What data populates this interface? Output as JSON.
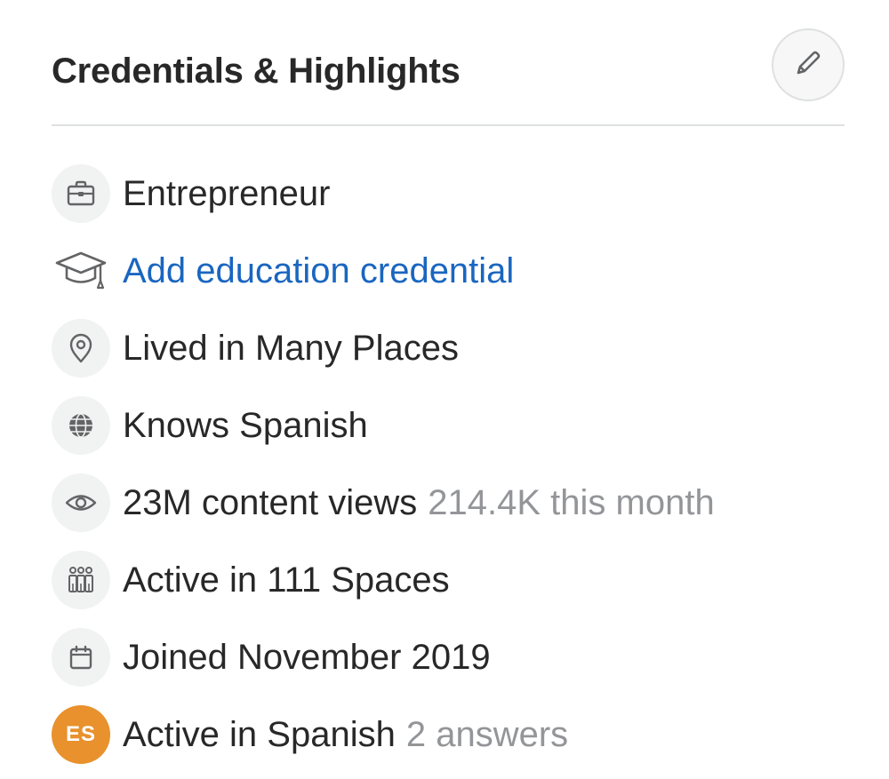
{
  "header": {
    "title": "Credentials & Highlights",
    "edit_icon": "pencil-icon"
  },
  "items": [
    {
      "icon": "briefcase-icon",
      "label": "Entrepreneur"
    },
    {
      "icon": "graduation-cap-icon",
      "label": "Add education credential",
      "is_link": true,
      "link_color": "#1a66c0"
    },
    {
      "icon": "location-pin-icon",
      "label": "Lived in Many Places"
    },
    {
      "icon": "globe-icon",
      "label": "Knows Spanish"
    },
    {
      "icon": "eye-icon",
      "label": "23M content views",
      "secondary": "214.4K this month"
    },
    {
      "icon": "people-group-icon",
      "label": "Active in 111 Spaces"
    },
    {
      "icon": "calendar-icon",
      "label": "Joined November 2019"
    },
    {
      "icon": "language-badge-icon",
      "badge_text": "ES",
      "badge_color": "#e8912d",
      "label": "Active in Spanish",
      "secondary": "2 answers"
    }
  ]
}
